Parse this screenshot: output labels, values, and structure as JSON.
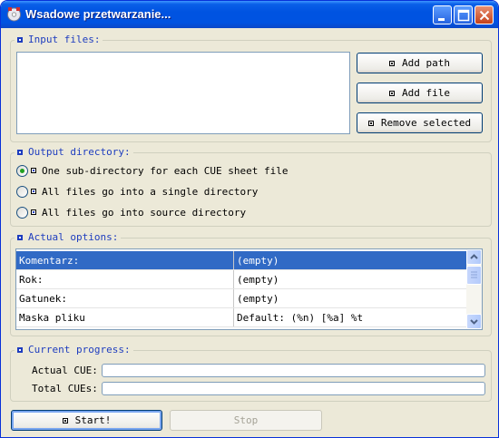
{
  "window": {
    "title": "Wsadowe przetwarzanie...",
    "icons": {
      "app": "cd-app-icon",
      "minimize": "minimize-icon",
      "maximize": "maximize-icon",
      "close": "close-icon"
    }
  },
  "input_files": {
    "legend": "Input files:",
    "add_path_label": "Add path",
    "add_file_label": "Add file",
    "remove_selected_label": "Remove selected",
    "files": []
  },
  "output_directory": {
    "legend": "Output directory:",
    "options": [
      {
        "label": "One sub-directory for each CUE sheet file",
        "checked": true
      },
      {
        "label": "All files go into a single directory",
        "checked": false
      },
      {
        "label": "All files go into source directory",
        "checked": false
      }
    ]
  },
  "actual_options": {
    "legend": "Actual options:",
    "rows": [
      {
        "key": "Komentarz:",
        "value": "(empty)",
        "selected": true
      },
      {
        "key": "Rok:",
        "value": "(empty)",
        "selected": false
      },
      {
        "key": "Gatunek:",
        "value": "(empty)",
        "selected": false
      },
      {
        "key": "Maska pliku",
        "value": "Default: (%n) [%a] %t",
        "selected": false
      }
    ]
  },
  "current_progress": {
    "legend": "Current progress:",
    "actual_cue_label": "Actual CUE:",
    "total_cues_label": "Total CUEs:",
    "actual_cue_progress": 0,
    "total_cues_progress": 0
  },
  "actions": {
    "start_label": "Start!",
    "stop_label": "Stop"
  },
  "colors": {
    "accent": "#0053e1",
    "legend_text": "#1e3dbf",
    "selection": "#316ac5",
    "window_bg": "#ece9d8"
  }
}
